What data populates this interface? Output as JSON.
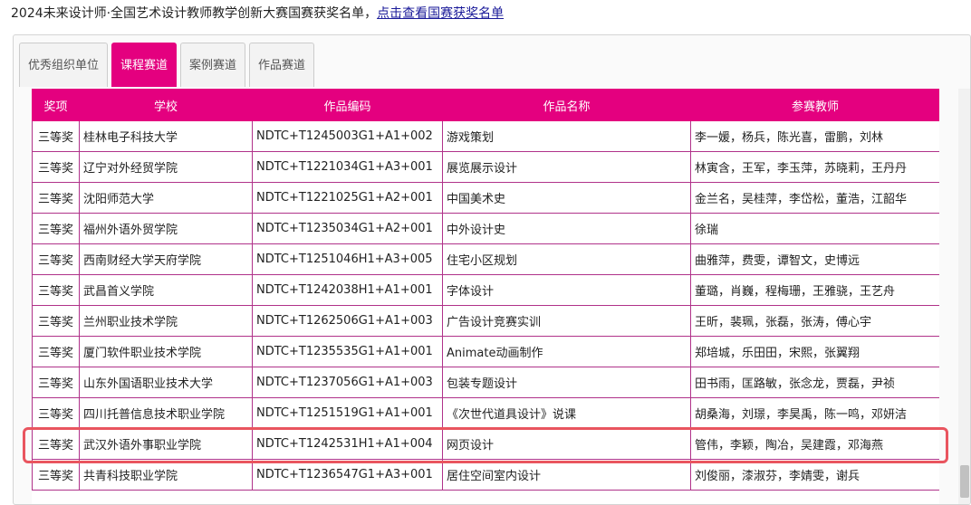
{
  "announcement": {
    "text": "2024未来设计师·全国艺术设计教师教学创新大赛国赛获奖名单，",
    "link": "点击查看国赛获奖名单"
  },
  "tabs": [
    {
      "label": "优秀组织单位",
      "active": false
    },
    {
      "label": "课程赛道",
      "active": true
    },
    {
      "label": "案例赛道",
      "active": false
    },
    {
      "label": "作品赛道",
      "active": false
    }
  ],
  "table": {
    "headers": [
      "奖项",
      "学校",
      "作品编码",
      "作品名称",
      "参赛教师"
    ],
    "rows": [
      [
        "三等奖",
        "桂林电子科技大学",
        "NDTC+T1245003G1+A1+002",
        "游戏策划",
        "李一媛，杨兵，陈光喜，雷鹏，刘林"
      ],
      [
        "三等奖",
        "辽宁对外经贸学院",
        "NDTC+T1221034G1+A3+001",
        "展览展示设计",
        "林寅含，王军，李玉萍，苏晓莉，王丹丹"
      ],
      [
        "三等奖",
        "沈阳师范大学",
        "NDTC+T1221025G1+A2+001",
        "中国美术史",
        "金兰名，吴桂萍，李岱松，董浩，江韶华"
      ],
      [
        "三等奖",
        "福州外语外贸学院",
        "NDTC+T1235034G1+A2+001",
        "中外设计史",
        "徐瑞"
      ],
      [
        "三等奖",
        "西南财经大学天府学院",
        "NDTC+T1251046H1+A3+005",
        "住宅小区规划",
        "曲雅萍，费雯，谭智文，史博远"
      ],
      [
        "三等奖",
        "武昌首义学院",
        "NDTC+T1242038H1+A1+001",
        "字体设计",
        "董璐，肖巍，程梅珊，王雅骁，王艺舟"
      ],
      [
        "三等奖",
        "兰州职业技术学院",
        "NDTC+T1262506G1+A1+003",
        "广告设计竞赛实训",
        "王昕，裴珮，张磊，张涛，傅心宇"
      ],
      [
        "三等奖",
        "厦门软件职业技术学院",
        "NDTC+T1235535G1+A1+001",
        "Animate动画制作",
        "郑培城，乐田田，宋熙，张翼翔"
      ],
      [
        "三等奖",
        "山东外国语职业技术大学",
        "NDTC+T1237056G1+A1+003",
        "包装专题设计",
        "田书雨，匡路敏，张念龙，贾磊，尹祯"
      ],
      [
        "三等奖",
        "四川托普信息技术职业学院",
        "NDTC+T1251519G1+A1+001",
        "《次世代道具设计》说课",
        "胡桑海，刘璟，李昊禹，陈一鸣，邓妍洁"
      ],
      [
        "三等奖",
        "武汉外语外事职业学院",
        "NDTC+T1242531H1+A1+004",
        "网页设计",
        "管伟，李颖，陶冶，吴建霞，邓海燕"
      ],
      [
        "三等奖",
        "共青科技职业学院",
        "NDTC+T1236547G1+A3+001",
        "居住空间室内设计",
        "刘俊丽，漆淑芬，李婧雯，谢兵"
      ]
    ]
  },
  "colors": {
    "accent": "#e4007f",
    "cell_border": "#b0328a",
    "highlight": "#e9555f"
  }
}
